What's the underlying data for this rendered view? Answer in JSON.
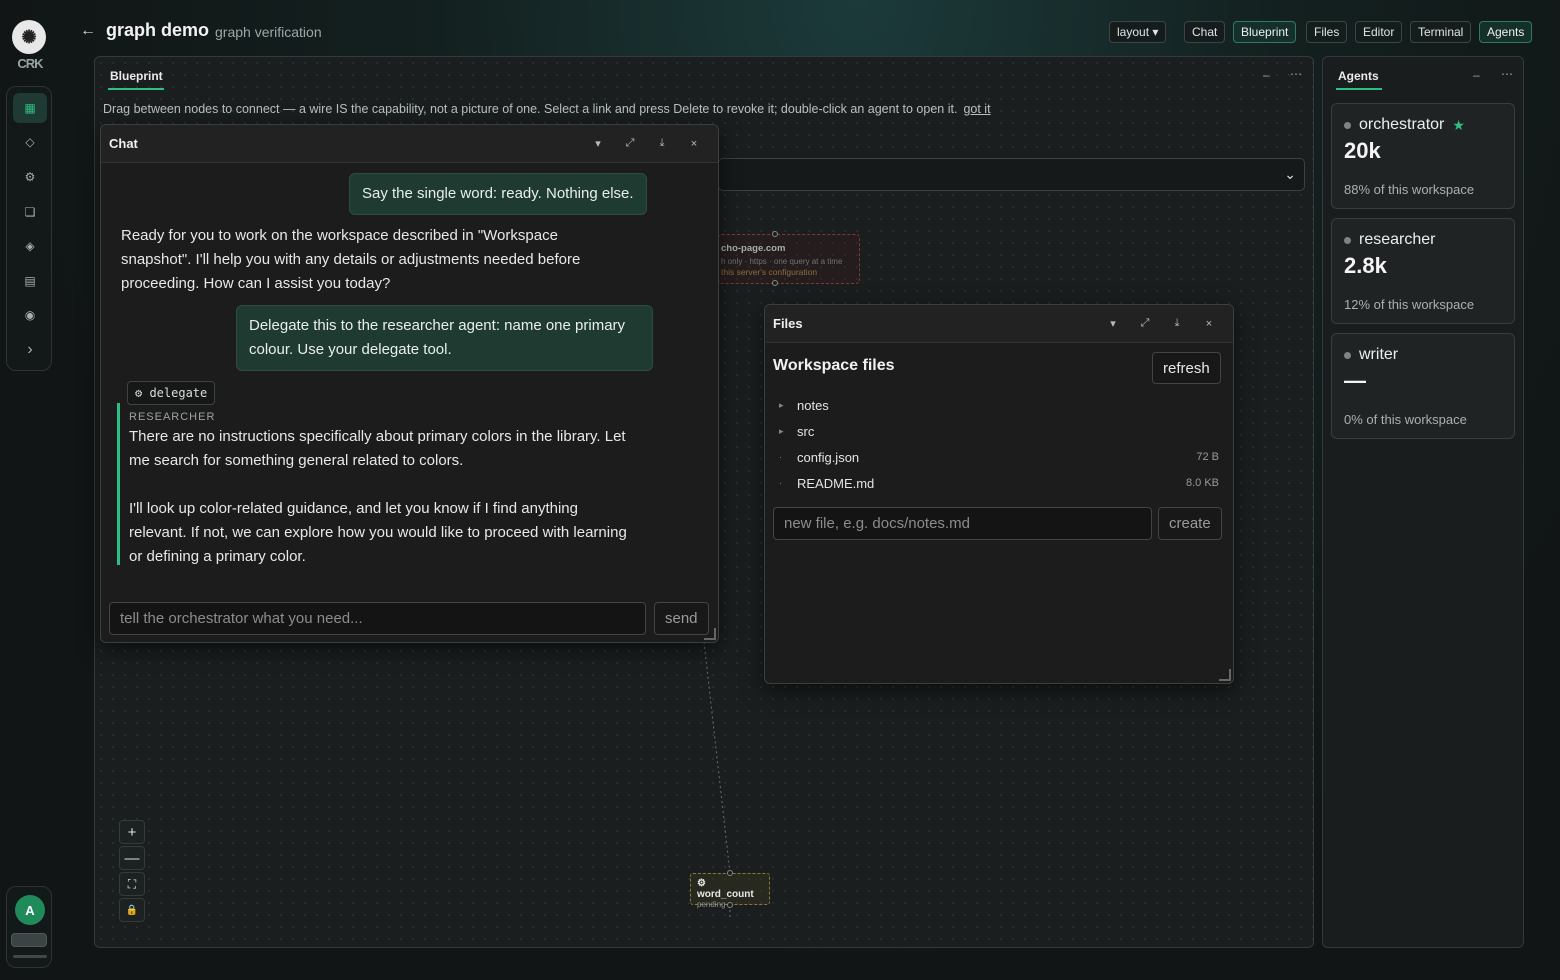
{
  "app": {
    "brand": "CRK",
    "workspace_title": "graph demo",
    "workspace_subtitle": "graph verification",
    "back_icon": "←"
  },
  "topbar": {
    "layout_label": "layout ▾",
    "buttons": [
      "Chat",
      "Blueprint",
      "Files",
      "Editor",
      "Terminal",
      "Agents"
    ],
    "active": [
      "Blueprint",
      "Agents"
    ]
  },
  "rail": {
    "icons": [
      "grid-icon",
      "diamond-icon",
      "gear-icon",
      "window-icon",
      "tag-icon",
      "list-icon",
      "target-icon",
      "chevron-right-icon"
    ],
    "avatar_letter": "A"
  },
  "blueprint": {
    "tab": "Blueprint",
    "hint": "Drag between nodes to connect — a wire IS the capability, not a picture of one. Select a link and press Delete to revoke it; double-click an agent to open it.",
    "hint_link": "got it",
    "node": {
      "title": "cho-page.com",
      "meta": "h only · https · one query at a time",
      "warn": "this server's configuration"
    },
    "tool_node": {
      "title": "⚙ word_count",
      "status": "pending"
    }
  },
  "chat": {
    "title": "Chat",
    "msg1": "Say the single word: ready. Nothing else.",
    "reply1": "Ready for you to work on the workspace described in \"Workspace snapshot\". I'll help you with any details or adjustments needed before proceeding. How can I assist you today?",
    "msg2": "Delegate this to the researcher agent: name one primary colour. Use your delegate tool.",
    "tool_chip": "⚙ delegate",
    "sub_agent": "RESEARCHER",
    "sub_text1": "There are no instructions specifically about primary colors in the library. Let me search for something general related to colors.",
    "sub_text2": "I'll look up color-related guidance, and let you know if I find anything relevant. If not, we can explore how you would like to proceed with learning or defining a primary color.",
    "input_placeholder": "tell the orchestrator what you need...",
    "send_label": "send"
  },
  "files": {
    "title": "Files",
    "heading": "Workspace files",
    "refresh_label": "refresh",
    "items": [
      {
        "caret": "▸",
        "name": "notes",
        "size": ""
      },
      {
        "caret": "▸",
        "name": "src",
        "size": ""
      },
      {
        "caret": "·",
        "name": "config.json",
        "size": "72 B"
      },
      {
        "caret": "·",
        "name": "README.md",
        "size": "8.0 KB"
      }
    ],
    "new_placeholder": "new file, e.g. docs/notes.md",
    "create_label": "create"
  },
  "agents": {
    "tab": "Agents",
    "cards": [
      {
        "name": "orchestrator",
        "tokens": "20k",
        "share": "88% of this workspace",
        "star": "★"
      },
      {
        "name": "researcher",
        "tokens": "2.8k",
        "share": "12% of this workspace",
        "star": ""
      },
      {
        "name": "writer",
        "tokens": "—",
        "share": "0% of this workspace",
        "star": ""
      }
    ]
  },
  "window_controls": {
    "menu": "▾",
    "expand": "⤢",
    "dock": "⤓",
    "close": "×",
    "minimize": "–",
    "more": "⋯"
  },
  "zoom": {
    "in": "+",
    "out": "—",
    "fit": "⛶",
    "lock": "🔒"
  }
}
